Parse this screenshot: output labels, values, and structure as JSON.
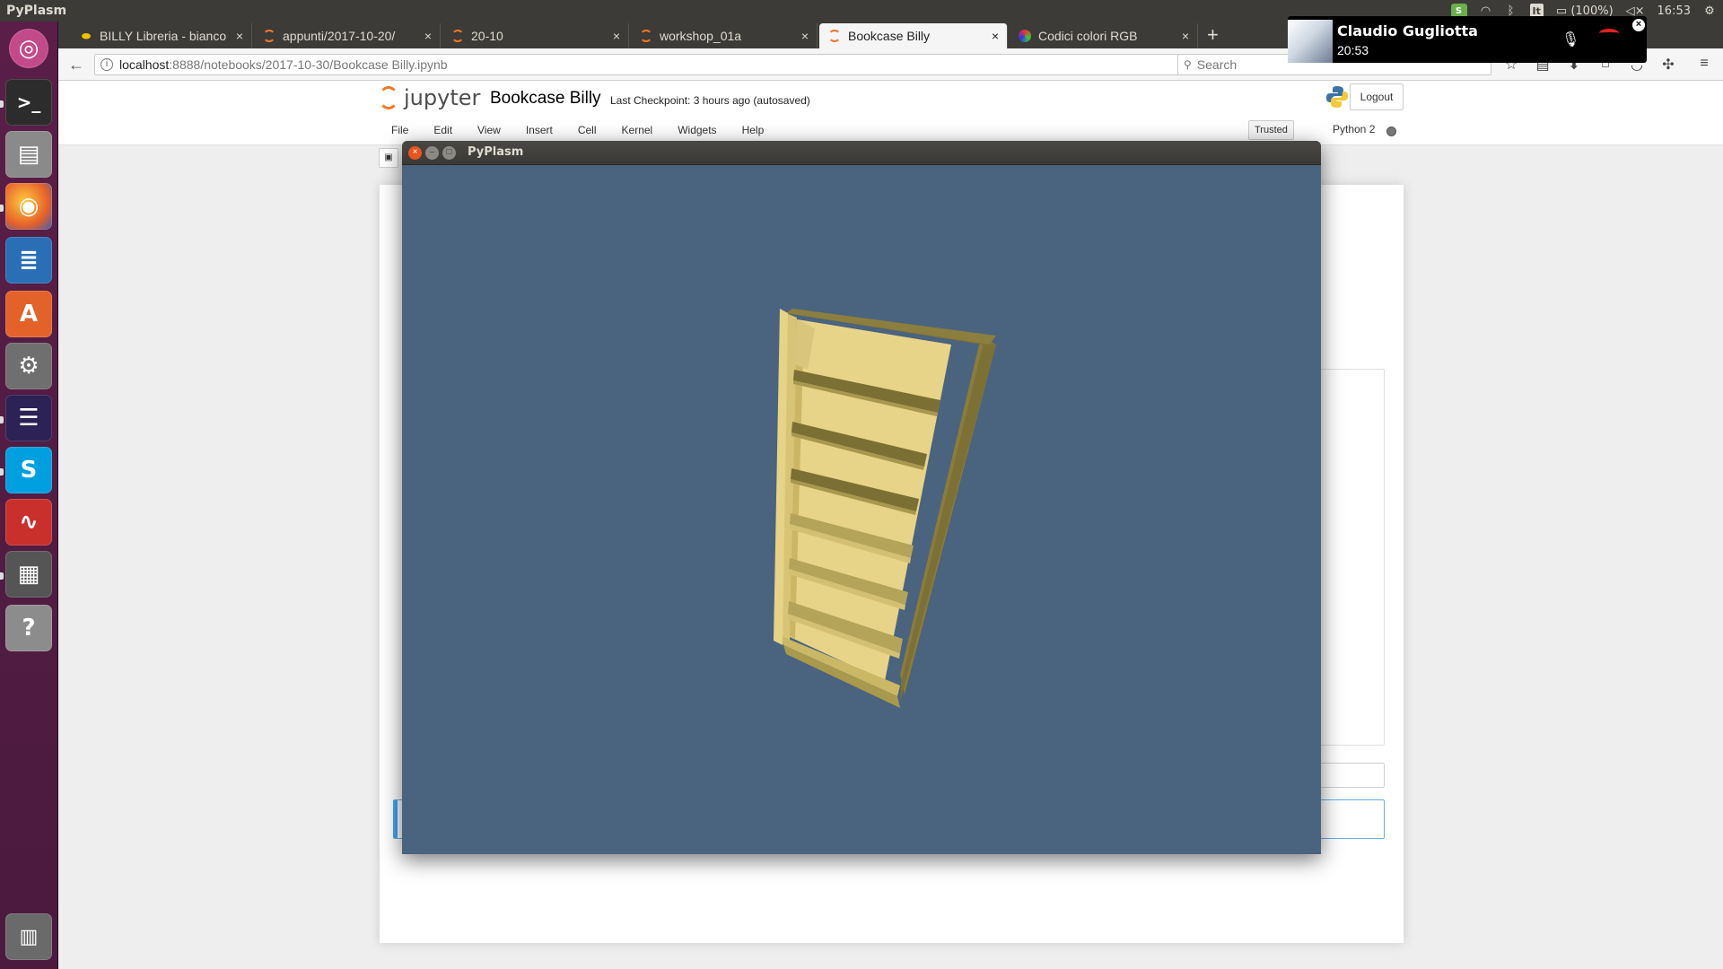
{
  "top_panel": {
    "title": "PyPlasm",
    "tray": {
      "skype_icon": "skype-icon",
      "wifi_icon": "wifi-icon",
      "bluetooth_icon": "bluetooth-icon",
      "keyboard_layout": "It",
      "battery_icon": "battery-icon",
      "battery_text": "(100%)",
      "volume_icon": "volume-mute-icon",
      "clock": "16:53",
      "settings_icon": "gear-icon"
    }
  },
  "launcher": {
    "items": [
      {
        "name": "ubuntu-dash-icon",
        "glyph": "◎"
      },
      {
        "name": "terminal-icon",
        "glyph": ">_"
      },
      {
        "name": "file-manager-icon",
        "glyph": "▤"
      },
      {
        "name": "firefox-icon",
        "glyph": "◉"
      },
      {
        "name": "writer-icon",
        "glyph": "≣"
      },
      {
        "name": "software-center-icon",
        "glyph": "A"
      },
      {
        "name": "system-settings-icon",
        "glyph": "⚙"
      },
      {
        "name": "eclipse-icon",
        "glyph": "☰"
      },
      {
        "name": "skype-icon",
        "glyph": "S"
      },
      {
        "name": "pdf-viewer-icon",
        "glyph": "∿"
      },
      {
        "name": "calculator-icon",
        "glyph": "▦"
      },
      {
        "name": "unknown-app-icon",
        "glyph": "?"
      },
      {
        "name": "trash-icon",
        "glyph": "🗑"
      }
    ]
  },
  "browser": {
    "tabs": [
      {
        "label": "BILLY Libreria - bianco",
        "icon": "ikea-favicon",
        "active": false
      },
      {
        "label": "appunti/2017-10-20/",
        "icon": "jupyter-favicon",
        "active": false
      },
      {
        "label": "20-10",
        "icon": "jupyter-favicon",
        "active": false
      },
      {
        "label": "workshop_01a",
        "icon": "jupyter-favicon",
        "active": false
      },
      {
        "label": "Bookcase Billy",
        "icon": "jupyter-favicon",
        "active": true
      },
      {
        "label": "Codici colori RGB",
        "icon": "rgb-favicon",
        "active": false
      }
    ],
    "url_host": "localhost",
    "url_rest": ":8888/notebooks/2017-10-30/Bookcase Billy.ipynb",
    "search_placeholder": "Search"
  },
  "jupyter": {
    "logo_text": "jupyter",
    "notebook_title": "Bookcase Billy",
    "checkpoint": "Last Checkpoint: 3 hours ago (autosaved)",
    "logout": "Logout",
    "menu": [
      "File",
      "Edit",
      "View",
      "Insert",
      "Cell",
      "Kernel",
      "Widgets",
      "Help"
    ],
    "trusted": "Trusted",
    "kernel": "Python 2"
  },
  "pyplasm": {
    "title": "PyPlasm",
    "background_color": "#4a637e",
    "model_color": "#e8d488",
    "model": "bookcase-3d-model"
  },
  "skype_notification": {
    "caller": "Claudio Gugliotta",
    "duration": "20:53"
  }
}
